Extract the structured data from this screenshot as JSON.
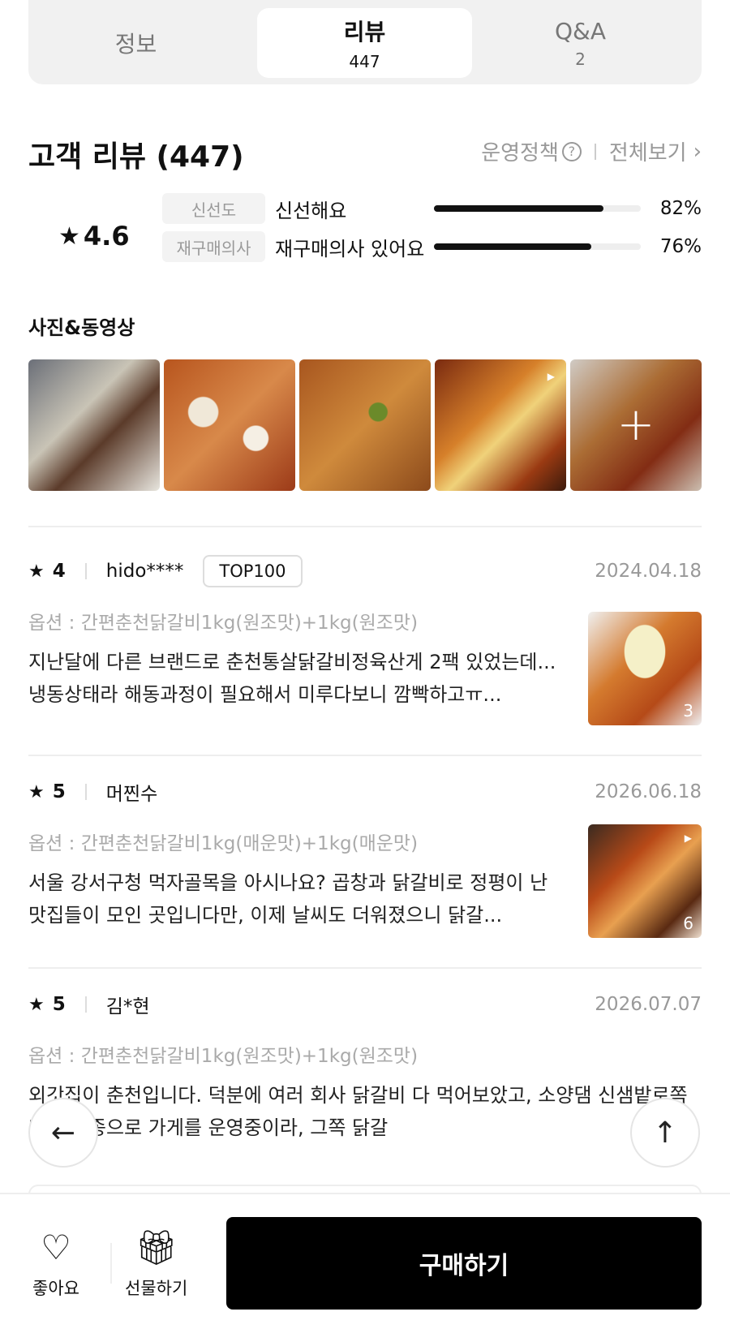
{
  "tabs": [
    {
      "label": "정보",
      "count": ""
    },
    {
      "label": "리뷰",
      "count": "447"
    },
    {
      "label": "Q&A",
      "count": "2"
    }
  ],
  "header": {
    "title": "고객 리뷰 (447)",
    "policy": "운영정책",
    "view_all": "전체보기"
  },
  "summary": {
    "score": "4.6",
    "metrics": [
      {
        "chip": "신선도",
        "value": "신선해요",
        "percent": "82%",
        "ratio": 0.82
      },
      {
        "chip": "재구매의사",
        "value": "재구매의사 있어요",
        "percent": "76%",
        "ratio": 0.76
      }
    ]
  },
  "photos": {
    "title": "사진&동영상"
  },
  "reviews": [
    {
      "rating": "4",
      "user": "hido****",
      "badge": "TOP100",
      "date": "2024.04.18",
      "option": "옵션 : 간편춘천닭갈비1kg(원조맛)+1kg(원조맛)",
      "text": "지난달에 다른 브랜드로 춘천통살닭갈비정육산게 2팩 있었는데...냉동상태라 해동과정이 필요해서 미루다보니 깜빡하고ㅠ...",
      "image_count": "3"
    },
    {
      "rating": "5",
      "user": "머찐수",
      "badge": "",
      "date": "2026.06.18",
      "option": "옵션 : 간편춘천닭갈비1kg(매운맛)+1kg(매운맛)",
      "text": "서울 강서구청 먹자골목을 아시나요? 곱창과 닭갈비로 정평이 난 맛집들이 모인 곳입니다만, 이제 날씨도 더워졌으니 닭갈...",
      "image_count": "6"
    },
    {
      "rating": "5",
      "user": "김*현",
      "badge": "",
      "date": "2026.07.07",
      "option": "옵션 : 간편춘천닭갈비1kg(원조맛)+1kg(원조맛)",
      "text": "외갓집이 춘천입니다. 덕분에 여러 회사 닭갈비 다 먹어보았고, 소양댐 신샘밭로쪽 다른 업종으로 가게를 운영중이라, 그쪽 닭갈"
    }
  ],
  "bottom": {
    "like": "좋아요",
    "gift": "선물하기",
    "buy": "구매하기"
  }
}
